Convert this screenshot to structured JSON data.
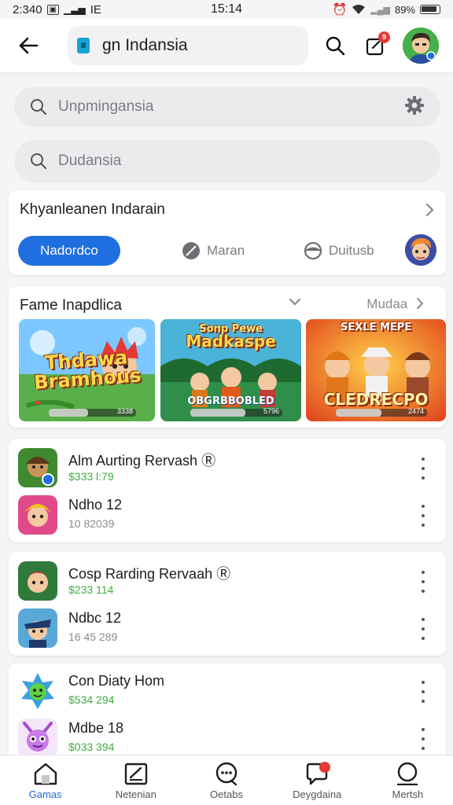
{
  "status_bar": {
    "time_left": "2:340",
    "indicators_left": "IE",
    "time_center": "15:14",
    "battery": "89%"
  },
  "top_bar": {
    "title": "gn Indansia",
    "notification_count": "9"
  },
  "search_primary": {
    "placeholder": "Unpmingansia"
  },
  "search_secondary": {
    "placeholder": "Dudansia"
  },
  "categories": {
    "header": "Khyanleanen Indarain",
    "chips": [
      {
        "label": "Nadordco",
        "active": true
      },
      {
        "label": "Maran",
        "icon": "leaf-icon"
      },
      {
        "label": "Duitusb",
        "icon": "ball-icon"
      }
    ]
  },
  "featured": {
    "header": "Fame Inapdlica",
    "more_label": "Mudaa",
    "tiles": [
      {
        "title_line1": "Thdawa",
        "title_line2": "Bramhous",
        "progress_value": "3338",
        "progress_fraction": 0.45
      },
      {
        "title_line1": "Sonp Pewe",
        "title_line2": "Madkaspe",
        "caption": "OBGRBBOBLED",
        "progress_value": "5796",
        "progress_fraction": 0.6
      },
      {
        "title_line1": "SEXLE MEPE",
        "title_line2": "CLEDRECPO",
        "progress_value": "2474",
        "progress_fraction": 0.5
      }
    ]
  },
  "lists": [
    {
      "rows": [
        {
          "name": "Alm Aurting Rervash Ⓡ",
          "meta": "$333 l:79",
          "meta_green": true
        },
        {
          "name": "Ndho 12",
          "meta": "10 82039",
          "meta_green": false
        }
      ]
    },
    {
      "rows": [
        {
          "name": "Cosp Rarding Rervaah Ⓡ",
          "meta": "$233 114",
          "meta_green": true
        },
        {
          "name": "Ndbc 12",
          "meta": "16 45 289",
          "meta_green": false
        }
      ]
    },
    {
      "rows": [
        {
          "name": "Con Diaty Hom",
          "meta": "$534 294",
          "meta_green": true
        },
        {
          "name": "Mdbe 18",
          "meta": "$033 394",
          "meta_green": true
        }
      ]
    }
  ],
  "bottom_nav": [
    {
      "label": "Gamas",
      "icon": "home-icon",
      "active": true
    },
    {
      "label": "Netenian",
      "icon": "edit-icon",
      "active": false
    },
    {
      "label": "Oetabs",
      "icon": "chat-icon",
      "active": false
    },
    {
      "label": "Deygdaina",
      "icon": "message-icon",
      "active": false,
      "badge": true
    },
    {
      "label": "Mertsh",
      "icon": "profile-icon",
      "active": false
    }
  ],
  "colors": {
    "accent": "#1f6fe0",
    "price_green": "#3cae3c",
    "badge_red": "#e53935"
  }
}
